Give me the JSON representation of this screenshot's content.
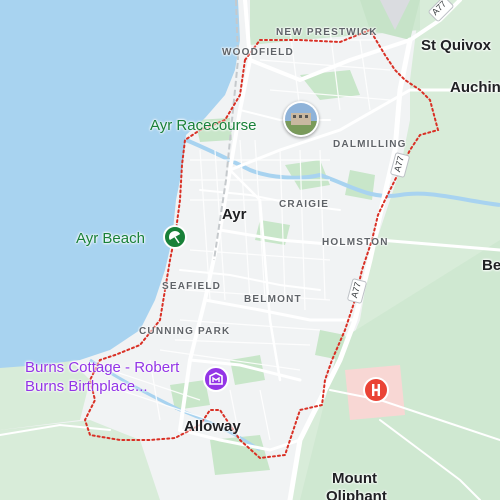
{
  "map": {
    "place_names": {
      "new_prestwick": "NEW PRESTWICK",
      "woodfield": "WOODFIELD",
      "st_quivox": "St Quivox",
      "auchin": "Auchin",
      "dalmilling": "DALMILLING",
      "craigie": "CRAIGIE",
      "ayr": "Ayr",
      "holmston": "HOLMSTON",
      "be": "Be",
      "seafield": "SEAFIELD",
      "belmont": "BELMONT",
      "cunning_park": "CUNNING PARK",
      "alloway": "Alloway",
      "mount_oliphant_1": "Mount",
      "mount_oliphant_2": "Oliphant"
    },
    "pois": {
      "racecourse": "Ayr Racecourse",
      "beach": "Ayr Beach",
      "burns_cottage_1": "Burns Cottage - Robert",
      "burns_cottage_2": "Burns Birthplace..."
    },
    "roads": {
      "a77_north": "A77",
      "a77_mid": "A77",
      "a77_south": "A77"
    },
    "icons": {
      "beach": "beach-umbrella-icon",
      "museum": "museum-icon",
      "hospital": "hospital-icon",
      "photo": "photo-thumbnail-icon"
    },
    "colors": {
      "water": "#a8d3f0",
      "land": "#f1f3f4",
      "park": "#c8e6c9",
      "boundary": "#d93025",
      "road": "#ffffff",
      "poi_green": "#188038",
      "poi_purple": "#9334e6",
      "hospital": "#ea4335"
    }
  }
}
